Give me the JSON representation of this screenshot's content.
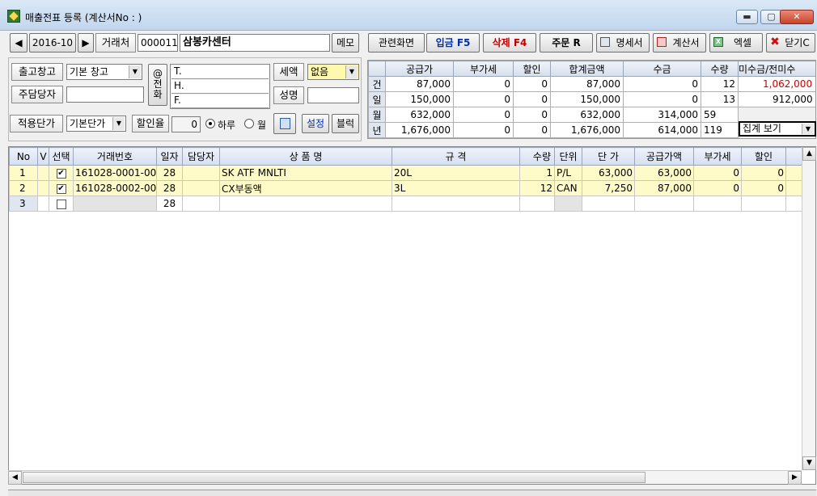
{
  "window": {
    "title": "매출전표 등록 (계산서No : )",
    "minimize": "▬",
    "maximize": "▢",
    "close": "✕"
  },
  "toolbar": {
    "prev": "◀",
    "date": "2016-10",
    "next": "▶",
    "partner_label": "거래처",
    "partner_code": "000011",
    "partner_name": "삼봉카센터",
    "memo": "메모",
    "related": "관련화면",
    "deposit": "입금 F5",
    "delete": "삭제 F4",
    "order": "주문 R",
    "statement": "명세서",
    "invoice": "계산서",
    "excel": "엑셀",
    "close": "닫기C"
  },
  "form": {
    "warehouse_label": "출고창고",
    "warehouse_value": "기본 창고",
    "manager_label": "주담당자",
    "manager_value": "",
    "price_label": "적용단가",
    "price_value": "기본단가",
    "discount_label": "할인율",
    "discount_value": "0",
    "day_option": "하루",
    "month_option": "월",
    "phone_btn": "@전화",
    "tel": "T.",
    "hp": "H.",
    "fax": "F.",
    "tax_label": "세액",
    "tax_value": "없음",
    "name_label": "성명",
    "name_value": "",
    "settings": "설정",
    "block": "블럭"
  },
  "stats": {
    "headers": [
      "공급가",
      "부가세",
      "할인",
      "합계금액",
      "수금",
      "수량",
      "미수금/전미수"
    ],
    "rows": [
      {
        "label": "건",
        "values": [
          "87,000",
          "0",
          "0",
          "87,000",
          "0",
          "12",
          "1,062,000"
        ]
      },
      {
        "label": "일",
        "values": [
          "150,000",
          "0",
          "0",
          "150,000",
          "0",
          "13",
          "912,000"
        ]
      },
      {
        "label": "월",
        "values": [
          "632,000",
          "0",
          "0",
          "632,000",
          "314,000",
          "59",
          ""
        ]
      },
      {
        "label": "년",
        "values": [
          "1,676,000",
          "0",
          "0",
          "1,676,000",
          "614,000",
          "119",
          ""
        ]
      }
    ],
    "summary_select": "집계 보기",
    "negative_color": "#cc0000"
  },
  "grid": {
    "headers": [
      "No",
      "V",
      "선택",
      "거래번호",
      "일자",
      "담당자",
      "상 품 명",
      "규 격",
      "수량",
      "단위",
      "단 가",
      "공급가액",
      "부가세",
      "할인"
    ],
    "rows": [
      {
        "no": "1",
        "v": "",
        "checked": "✔",
        "trade_no": "161028-0001-00",
        "day": "28",
        "manager": "",
        "product": "SK ATF MNLTI",
        "spec": "20L",
        "qty": "1",
        "unit": "P/L",
        "price": "63,000",
        "supply": "63,000",
        "vat": "0",
        "discount": "0"
      },
      {
        "no": "2",
        "v": "",
        "checked": "✔",
        "trade_no": "161028-0002-00",
        "day": "28",
        "manager": "",
        "product": "CX부동액",
        "spec": "3L",
        "qty": "12",
        "unit": "CAN",
        "price": "7,250",
        "supply": "87,000",
        "vat": "0",
        "discount": "0"
      },
      {
        "no": "3",
        "v": "",
        "checked": "",
        "trade_no": "",
        "day": "28",
        "manager": "",
        "product": "",
        "spec": "",
        "qty": "",
        "unit": "",
        "price": "",
        "supply": "",
        "vat": "",
        "discount": ""
      }
    ]
  },
  "scroll": {
    "up": "▲",
    "down": "▼",
    "left": "◀",
    "right": "▶"
  }
}
